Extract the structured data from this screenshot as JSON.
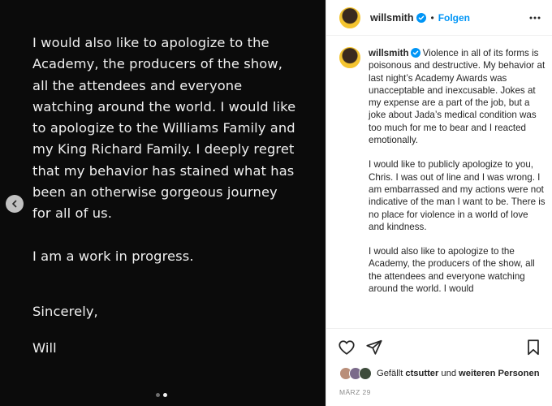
{
  "media": {
    "lines": [
      "I would also like to apologize to the",
      "Academy, the producers of the show,",
      "all the attendees and everyone",
      "watching around the world. I would like",
      "to apologize to the Williams Family and",
      "my King Richard Family. I deeply regret",
      "that my behavior has stained what has",
      "been an otherwise gorgeous journey",
      "for all of us."
    ],
    "progress": "I am a work in progress.",
    "closing": "Sincerely,",
    "signature": "Will",
    "carousel": {
      "total": 2,
      "current": 2
    }
  },
  "header": {
    "username": "willsmith",
    "separator": "•",
    "follow_label": "Folgen"
  },
  "caption": {
    "username": "willsmith",
    "p1": "Violence in all of its forms is poisonous and destructive. My behavior at last night’s Academy Awards was unacceptable and inexcusable. Jokes at my expense are a part of the job, but a joke about Jada’s medical condition was too much for me to bear and I reacted emotionally.",
    "p2": "I would like to publicly apologize to you, Chris. I was out of line and I was wrong. I am embarrassed and my actions were not indicative of the man I want to be. There is no place for violence in a world of love and kindness.",
    "p3": "I would also like to apologize to the Academy, the producers of the show, all the attendees and everyone watching around the world. I would"
  },
  "likes": {
    "prefix": "Gefällt",
    "user": "ctsutter",
    "middle": "und",
    "rest": "weiteren Personen"
  },
  "date": "MÄRZ 29",
  "colors": {
    "verified": "#0095f6",
    "follow": "#0095f6",
    "avatar_ring": "#f4c430"
  },
  "icons": [
    "chevron-left-icon",
    "verified-badge-icon",
    "more-options-icon",
    "heart-icon",
    "share-icon",
    "bookmark-icon"
  ]
}
